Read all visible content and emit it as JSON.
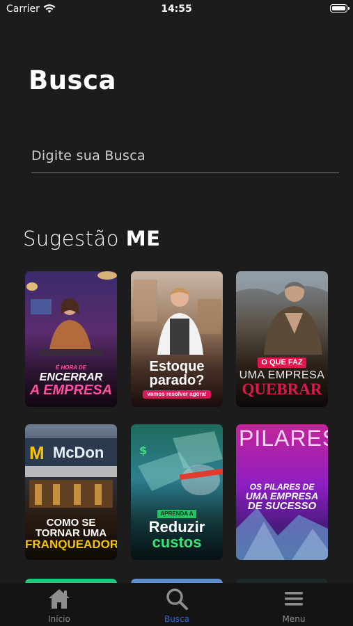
{
  "status_bar": {
    "carrier": "Carrier",
    "time": "14:55"
  },
  "page": {
    "title": "Busca"
  },
  "search": {
    "placeholder": "Digite sua Busca",
    "value": ""
  },
  "section": {
    "title_light": "Sugestão ",
    "title_bold": "ME"
  },
  "cards": [
    {
      "small": "É HORA DE",
      "line1": "ENCERRAR",
      "line2": "A EMPRESA"
    },
    {
      "line1": "Estoque",
      "line2": "parado?",
      "pill": "vamos resolver agora!"
    },
    {
      "tag": "O QUE FAZ",
      "line1": "UMA EMPRESA",
      "line2": "QUEBRAR"
    },
    {
      "sign": "McDon",
      "line1": "COMO SE",
      "line2": "TORNAR UMA",
      "line3": "FRANQUEADORA"
    },
    {
      "tag": "APRENDA A",
      "line1": "Reduzir",
      "line2": "custos"
    },
    {
      "top": "PILARES",
      "line1": "OS PILARES DE",
      "line2": "UMA EMPRESA",
      "line3": "DE SUCESSO"
    }
  ],
  "tabs": [
    {
      "label": "Início",
      "icon": "home-icon",
      "active": false
    },
    {
      "label": "Busca",
      "icon": "search-icon",
      "active": true
    },
    {
      "label": "Menu",
      "icon": "menu-icon",
      "active": false
    }
  ],
  "colors": {
    "background": "#1c1c1c",
    "active_tab": "#3566d9",
    "inactive_tab": "#8e8e8e",
    "accent_pink": "#e0174f"
  }
}
